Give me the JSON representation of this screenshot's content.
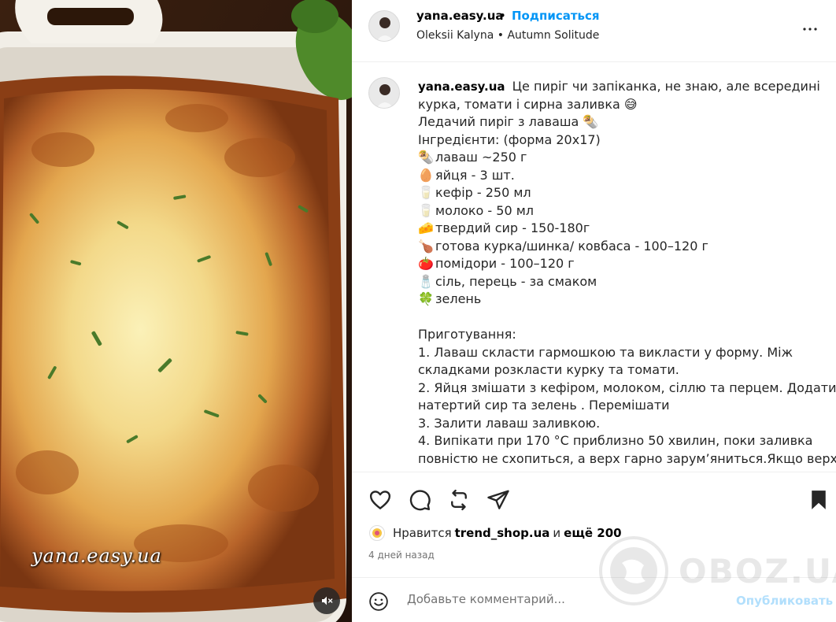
{
  "post": {
    "username": "yana.easy.ua",
    "follow_label": "Подписаться",
    "separator": "•",
    "audio_artist": "Oleksii Kalyna",
    "audio_track": "Autumn Solitude",
    "media_watermark": "yana.easy.ua"
  },
  "caption": {
    "username": "yana.easy.ua",
    "lines": [
      {
        "emoji": "",
        "text": "Це пиріг чи запіканка, не знаю, але всередині"
      },
      {
        "emoji": "",
        "text": "курка, томати і сирна заливка 😅"
      },
      {
        "emoji": "",
        "text": "Ледачий пиріг з лаваша 🌯"
      },
      {
        "emoji": "",
        "text": "Інгредієнти: (форма 20х17)"
      },
      {
        "emoji": "🌯",
        "text": "лаваш ~250 г"
      },
      {
        "emoji": "🥚",
        "text": "яйця - 3 шт."
      },
      {
        "emoji": "🥛",
        "text": "кефір - 250 мл"
      },
      {
        "emoji": "🥛",
        "text": "молоко - 50 мл"
      },
      {
        "emoji": "🧀",
        "text": "твердий сир - 150-180г"
      },
      {
        "emoji": "🍗",
        "text": "готова курка/шинка/ ковбаса - 100–120 г"
      },
      {
        "emoji": "🍅",
        "text": "помідори - 100–120 г"
      },
      {
        "emoji": "🧂",
        "text": "сіль, перець - за смаком"
      },
      {
        "emoji": "🍀",
        "text": "зелень"
      },
      {
        "emoji": "",
        "text": ""
      },
      {
        "emoji": "",
        "text": "Приготування:"
      },
      {
        "emoji": "",
        "text": "1. Лаваш скласти гармошкою та викласти у форму. Між"
      },
      {
        "emoji": "",
        "text": "складками розкласти курку та томати."
      },
      {
        "emoji": "",
        "text": "2. Яйця змішати з кефіром, молоком, сіллю та перцем. Додати"
      },
      {
        "emoji": "",
        "text": "натертий сир та зелень . Перемішати"
      },
      {
        "emoji": "",
        "text": "3. Залити лаваш заливкою."
      },
      {
        "emoji": "",
        "text": "4. Випікати при 170 °С приблизно 50 хвилин, поки заливка"
      },
      {
        "emoji": "",
        "text": "повністю не схопиться, а верх гарно зарум’яниться.Якщо верх"
      }
    ]
  },
  "likes": {
    "prefix": "Нравится",
    "user": "trend_shop.ua",
    "connector": "и",
    "rest": "ещё 200"
  },
  "time_ago": "4 дней назад",
  "comment": {
    "placeholder": "Добавьте комментарий...",
    "publish_label": "Опубликовать"
  },
  "overlay_watermark": "OBOZ.UA",
  "icons": {
    "like": "heart-icon",
    "comment": "comment-icon",
    "repost": "repost-icon",
    "share": "send-icon",
    "save": "bookmark-icon",
    "mute": "speaker-muted-icon",
    "emoji": "smiley-icon"
  },
  "colors": {
    "accent": "#0095f6",
    "publish_disabled": "#b2dffc",
    "secondary_text": "#737373"
  }
}
